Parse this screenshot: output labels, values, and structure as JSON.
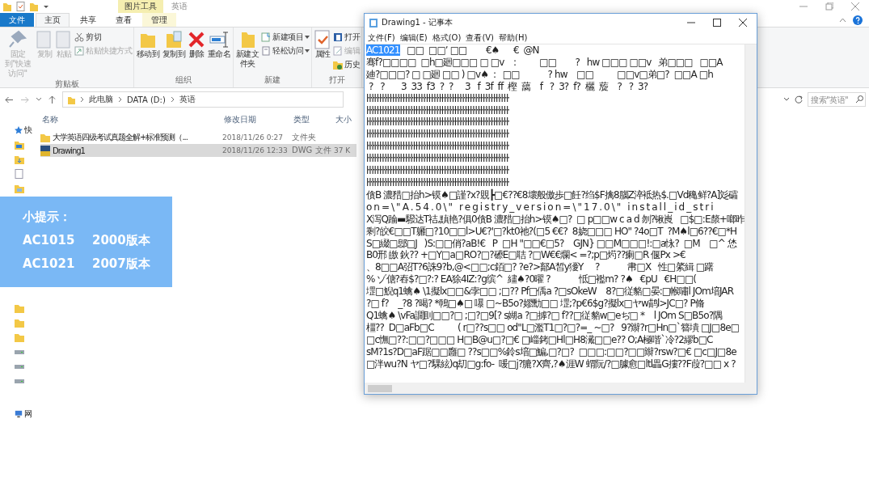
{
  "explorer": {
    "title": "英语",
    "context_tab_group": "图片工具",
    "tabs": [
      {
        "label": "文件",
        "kind": "file",
        "selected": false
      },
      {
        "label": "主页",
        "kind": "normal",
        "selected": true
      },
      {
        "label": "共享",
        "kind": "normal",
        "selected": false
      },
      {
        "label": "查看",
        "kind": "normal",
        "selected": false
      },
      {
        "label": "管理",
        "kind": "context",
        "selected": false
      }
    ],
    "ribbon_groups": [
      {
        "label": "剪贴板",
        "items": [
          {
            "label": "固定到\"快速访问\"",
            "kind": "pin",
            "disabled": true
          },
          {
            "label": "复制",
            "kind": "copy",
            "disabled": true
          },
          {
            "label": "粘贴",
            "kind": "paste",
            "disabled": true
          },
          {
            "label": "剪切",
            "kind": "cut",
            "disabled": false
          },
          {
            "label": "粘贴快捷方式",
            "kind": "shortcut",
            "disabled": true
          }
        ]
      },
      {
        "label": "组织",
        "items": [
          {
            "label": "移动到",
            "kind": "move",
            "disabled": false
          },
          {
            "label": "复制到",
            "kind": "copyto",
            "disabled": false
          },
          {
            "label": "删除",
            "kind": "delete",
            "disabled": false
          },
          {
            "label": "重命名",
            "kind": "rename",
            "disabled": false
          }
        ]
      },
      {
        "label": "新建",
        "items": [
          {
            "label": "新建文件夹",
            "kind": "newfolder",
            "disabled": false
          },
          {
            "label": "新建项目",
            "kind": "newitem",
            "disabled": false
          },
          {
            "label": "轻松访问",
            "kind": "easyaccess",
            "disabled": false
          }
        ]
      },
      {
        "label": "打开",
        "items": [
          {
            "label": "属性",
            "kind": "properties",
            "disabled": false
          },
          {
            "label": "打开",
            "kind": "open",
            "disabled": false
          },
          {
            "label": "编辑",
            "kind": "edit",
            "disabled": true
          },
          {
            "label": "历史",
            "kind": "history",
            "disabled": false
          }
        ]
      }
    ],
    "path": [
      "此电脑",
      "DATA (D:)",
      "英语"
    ],
    "search": {
      "placeholder": "搜索\"英语\""
    },
    "nav_groups": [
      {
        "items": [
          {
            "label": "快",
            "kind": "star"
          },
          {
            "kind": "desktop"
          },
          {
            "kind": "download"
          },
          {
            "kind": "document"
          },
          {
            "kind": "picture"
          }
        ]
      },
      {
        "items": [
          {
            "kind": "folder"
          },
          {
            "kind": "folder"
          },
          {
            "kind": "folder"
          },
          {
            "kind": "drive"
          },
          {
            "kind": "drive"
          },
          {
            "kind": "drive"
          }
        ]
      },
      {
        "items": [
          {
            "label": "网",
            "kind": "network"
          }
        ]
      }
    ],
    "columns": [
      "名称",
      "修改日期",
      "类型",
      "大小"
    ],
    "rows": [
      {
        "name": "大学英语四级考试真题全解+标准预测（...",
        "date": "2018/11/26 0:27",
        "type": "文件夹",
        "kind": "folder",
        "selected": false
      },
      {
        "name": "Drawing1",
        "date": "2018/11/26 12:33",
        "type": "DWG 文件",
        "size": "37 K",
        "kind": "dwg",
        "selected": true
      }
    ]
  },
  "tip": {
    "title": "小提示：",
    "entries": [
      {
        "code": "AC1015",
        "version": "2000版本"
      },
      {
        "code": "AC1021",
        "version": "2007版本"
      }
    ]
  },
  "notepad": {
    "title": "Drawing1 - 记事本",
    "menu": [
      "文件(F)",
      "编辑(E)",
      "格式(O)",
      "查看(V)",
      "帮助(H)"
    ],
    "lines": [
      {
        "highlight": "AC1021",
        "text": "   □□  □□ʼ □□        €♠      €  @N"
      },
      {
        "text": "骞f?□□□□  □h□廻□□□ □ □v    :          □□        ?   hw □□□ □□v   弟□□□   □□A"
      },
      {
        "text": "廸?□□□? □ □廻 □□ ) □v♠  :   □□            ? hw    □□          □□v□弟□?  □□A □h"
      },
      {
        "text": " ?   ?       3  33  f3  ?  ?     3   f  3f  ff  樫  藹    f   ?  3?  f?  欐  蔙    ?   ?  3?"
      },
      {
        "text": "ŀŀŀŀŀŀŀŀŀŀŀŀŀŀŀŀŀŀŀŀŀŀŀŀŀŀŀŀŀŀŀŀŀŀŀŀŀŀŀŀŀŀŀŀŀŀŀŀŀŀŀŀŀŀŀ"
      },
      {
        "text": "ŀŀŀŀŀŀŀŀŀŀŀŀŀŀŀŀŀŀŀŀŀŀŀŀŀŀŀŀŀŀŀŀŀŀŀŀŀŀŀŀŀŀŀŀŀŀŀŀŀŀŀŀŀŀŀ"
      },
      {
        "text": "ŀŀŀŀŀŀŀŀŀŀŀŀŀŀŀŀŀŀŀŀŀŀŀŀŀŀŀŀŀŀŀŀŀŀŀŀŀŀŀŀŀŀŀŀŀŀŀŀŀŀŀŀŀŀŀ"
      },
      {
        "text": "ŀŀŀŀŀŀŀŀŀŀŀŀŀŀŀŀŀŀŀŀŀŀŀŀŀŀŀŀŀŀŀŀŀŀŀŀŀŀŀŀŀŀŀŀŀŀŀŀŀŀŀŀŀŀŀ"
      },
      {
        "text": "ŀŀŀŀŀŀŀŀŀŀŀŀŀŀŀŀŀŀŀŀŀŀŀŀŀŀŀŀŀŀŀŀŀŀŀŀŀŀŀŀŀŀŀŀŀŀŀŀŀŀŀŀŀŀŀ"
      },
      {
        "text": "ŀŀŀŀŀŀŀŀŀŀŀŀŀŀŀŀŀŀŀŀŀŀŀŀŀŀŀŀŀŀŀŀŀŀŀŀŀŀŀŀŀŀŀŀŀŀŀŀŀŀŀŀŀŀŀ"
      },
      {
        "text": "ŀŀŀŀŀŀŀŀŀŀŀŀŀŀŀŀŀŀŀŀŀŀŀŀŀŀŀŀŀŀŀŀŀŀŀŀŀŀŀŀŀŀŀŀŀŀŀŀŀŀŀŀŀŀŀ"
      },
      {
        "text": "ŀŀŀŀŀŀŀŀŀŀŀŀŀŀŀŀŀŀŀŀŀŀŀŀŀŀŀŀŀŀŀŀŀŀŀŀŀŀŀŀŀŀŀŀŀŀŀŀŀŀŀŀŀŀŀ"
      },
      {
        "text": "僋B 濃矠□抬h>镆♠□謹?x?覞┣□€??€8壞般傲歩□飪?绉$F擒8腦Z淬袛热$.□Vd穐鲜?A]彣礵"
      },
      {
        "text": "o n = \\ \" A . 5 4 . 0 \\ \"   r e g i s t r y _ v e r s i o n = \\ \" 1 7 . 0 \\ \"   i n s t a l l _ i d _ s t r i"
      },
      {
        "text": "X泻Q踚▬驋达T祮,黰艳?俱0僋B 濃矠□抬h>镆♠□?  □ p□□w c a d 刎?锹崀   □$□:E漦+啷昨"
      },
      {
        "text": "剩?皎€□□T軅□?10□□l>U€?'□?kt0祂?(□5 €€?  8娆□□□ HO\" ?4o□T  ?M♠l□6??€□*H"
      },
      {
        "text": "S□綴□鄎□J   )S:□□俏?aB!€   P  □H \"□□€□5?    GJN} □□M□□□!:□a怺?  □M    □^ 恷"
      },
      {
        "text": "B0邢 皦 鈥?? +□Y□a□RO?□?礤E□聐 ?□W€€爛< =?;p□烵??瘌□R 偃Px >€"
      },
      {
        "text": "、8□□A弨T?6誅9?b,@<□□;c銆□? ?e?>鄐A皙y獶Y     ?            帇□X   性□綮緝 □躇"
      },
      {
        "text": "% ゾ傏?舂$?□?:? EA狳4IZ:?g缤^  繣♠?0曜 ?            怟□襤m? ?♠   €pU   €H□□("
      },
      {
        "text": "堽□鯢q1蠄♠ \\1擬lx□□&孛□□ ;□?? Pf□偊a ?□sOkeW    8?□従貉□晏:□帿嘯l JOm堷JAR"
      },
      {
        "text": "?□ f?    _?8 ?暍? *鳾□♠□ 嚗 □~B5o?嫪勳□□ 堽;?p€6$g?擬lx□ヤw鹋l>JC□? P脩"
      },
      {
        "text": "Q1蠄♠ \\vFa譋刞□□?□ ;□?□9[? s媩a ?□摢?□ f??□従貉w□eぢ□ *    l JOm S□B5o?隅"
      },
      {
        "text": "橿??  D□aFb□C          ( r□??s□□ od\"L□濫T1□?□?=_ ~□?   9?辮?r□Hn□`簪墤 □J□8e□"
      },
      {
        "text": "□c憮□??:□□?□□□ H□B@u□?□€ □崰銬□Hl□H8瀻□□e?? O;A極喈`冷?2繆b□C"
      },
      {
        "text": "sM?1s?D□aF踞□□廱□ ??s□□%鈴s堷□鯿,□?□?  □□□:□□?□□辮?rsw?□€ □c□J□8e"
      },
      {
        "text": "□泮wu?N ヤ□?騍絃)q刧□g:fo-  喛□j?膔?X齊,?♠涯W 蝟阮/?□臄愈□ltl畾G摟??F葭?□□ x ?"
      }
    ]
  }
}
